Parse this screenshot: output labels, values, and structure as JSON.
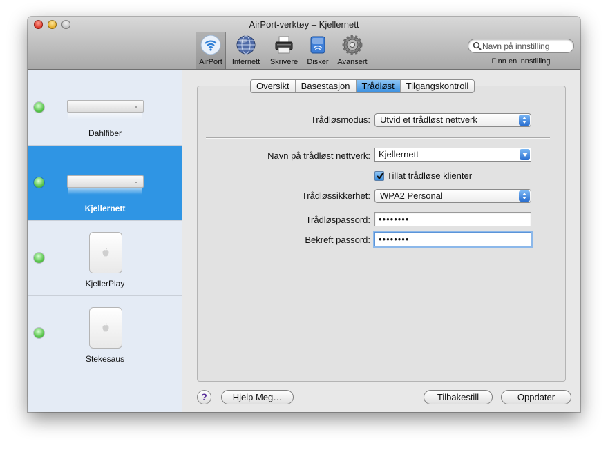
{
  "window": {
    "title": "AirPort-verktøy – Kjellernett"
  },
  "toolbar": {
    "items": [
      {
        "label": "AirPort",
        "icon": "airport-wifi-icon"
      },
      {
        "label": "Internett",
        "icon": "globe-icon"
      },
      {
        "label": "Skrivere",
        "icon": "printer-icon"
      },
      {
        "label": "Disker",
        "icon": "disk-icon"
      },
      {
        "label": "Avansert",
        "icon": "gear-icon"
      }
    ],
    "selected": "AirPort"
  },
  "search": {
    "placeholder": "Navn på innstilling",
    "caption": "Finn en innstilling"
  },
  "sidebar": {
    "stations": [
      {
        "name": "Dahlfiber",
        "status": "green",
        "device": "airport-extreme"
      },
      {
        "name": "Kjellernett",
        "status": "green",
        "device": "airport-extreme",
        "selected": true
      },
      {
        "name": "KjellerPlay",
        "status": "green",
        "device": "airport-express"
      },
      {
        "name": "Stekesaus",
        "status": "green",
        "device": "airport-express"
      }
    ]
  },
  "tabs": [
    {
      "label": "Oversikt"
    },
    {
      "label": "Basestasjon"
    },
    {
      "label": "Trådløst",
      "selected": true
    },
    {
      "label": "Tilgangskontroll"
    }
  ],
  "form": {
    "wireless_mode_label": "Trådløsmodus:",
    "wireless_mode_value": "Utvid et trådløst nettverk",
    "network_name_label": "Navn på trådløst nettverk:",
    "network_name_value": "Kjellernett",
    "allow_clients_label": "Tillat trådløse klienter",
    "allow_clients_checked": true,
    "security_label": "Trådløssikkerhet:",
    "security_value": "WPA2 Personal",
    "password_label": "Trådløspassord:",
    "password_value": "••••••••",
    "confirm_label": "Bekreft passord:",
    "confirm_value": "••••••••"
  },
  "buttons": {
    "help": "?",
    "help_me": "Hjelp Meg…",
    "revert": "Tilbakestill",
    "update": "Oppdater"
  },
  "colors": {
    "selection_blue": "#2f95e4",
    "status_green": "#59c44c",
    "sidebar_bg": "#e4ebf5"
  }
}
